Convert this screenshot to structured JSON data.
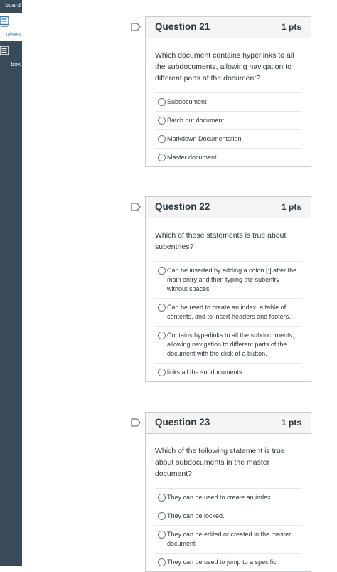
{
  "sidebar": {
    "items": [
      {
        "label": "board",
        "icon": "dashboard-icon",
        "active": false
      },
      {
        "label": "urses",
        "icon": "courses-icon",
        "active": true
      },
      {
        "label": "box",
        "icon": "inbox-icon",
        "active": false
      }
    ]
  },
  "questions": [
    {
      "title": "Question 21",
      "points": "1 pts",
      "text": "Which document contains hyperlinks to all the subdocuments, allowing navigation to different parts of the document?",
      "answers": [
        "Subdocument",
        "Batch put document.",
        "Markdown Documentation",
        "Master document"
      ]
    },
    {
      "title": "Question 22",
      "points": "1 pts",
      "text": "Which of these statements is true about subentries?",
      "answers": [
        "Can be inserted by adding a colon [:] after the main entry and then typing the subentry without spaces.",
        "Can be used to create an index, a table of contents, and to insert headers and footers.",
        "Contains hyperlinks to all the subdocuments, allowing navigation to different parts of the document with the click of a button.",
        "links all the subdocuments"
      ]
    },
    {
      "title": "Question 23",
      "points": "1 pts",
      "text": "Which of the following statement is true about subdocuments in the master document?",
      "answers": [
        "They can be used to create an index.",
        "They can be locked.",
        "They can be edited or created in the master document.",
        "They can be used to jump to a specific"
      ]
    }
  ],
  "colors": {
    "sidebar_bg": "#394b58",
    "active_link": "#2b7abc",
    "card_header_bg": "#f5f5f5",
    "card_border": "#c7cdd1"
  }
}
